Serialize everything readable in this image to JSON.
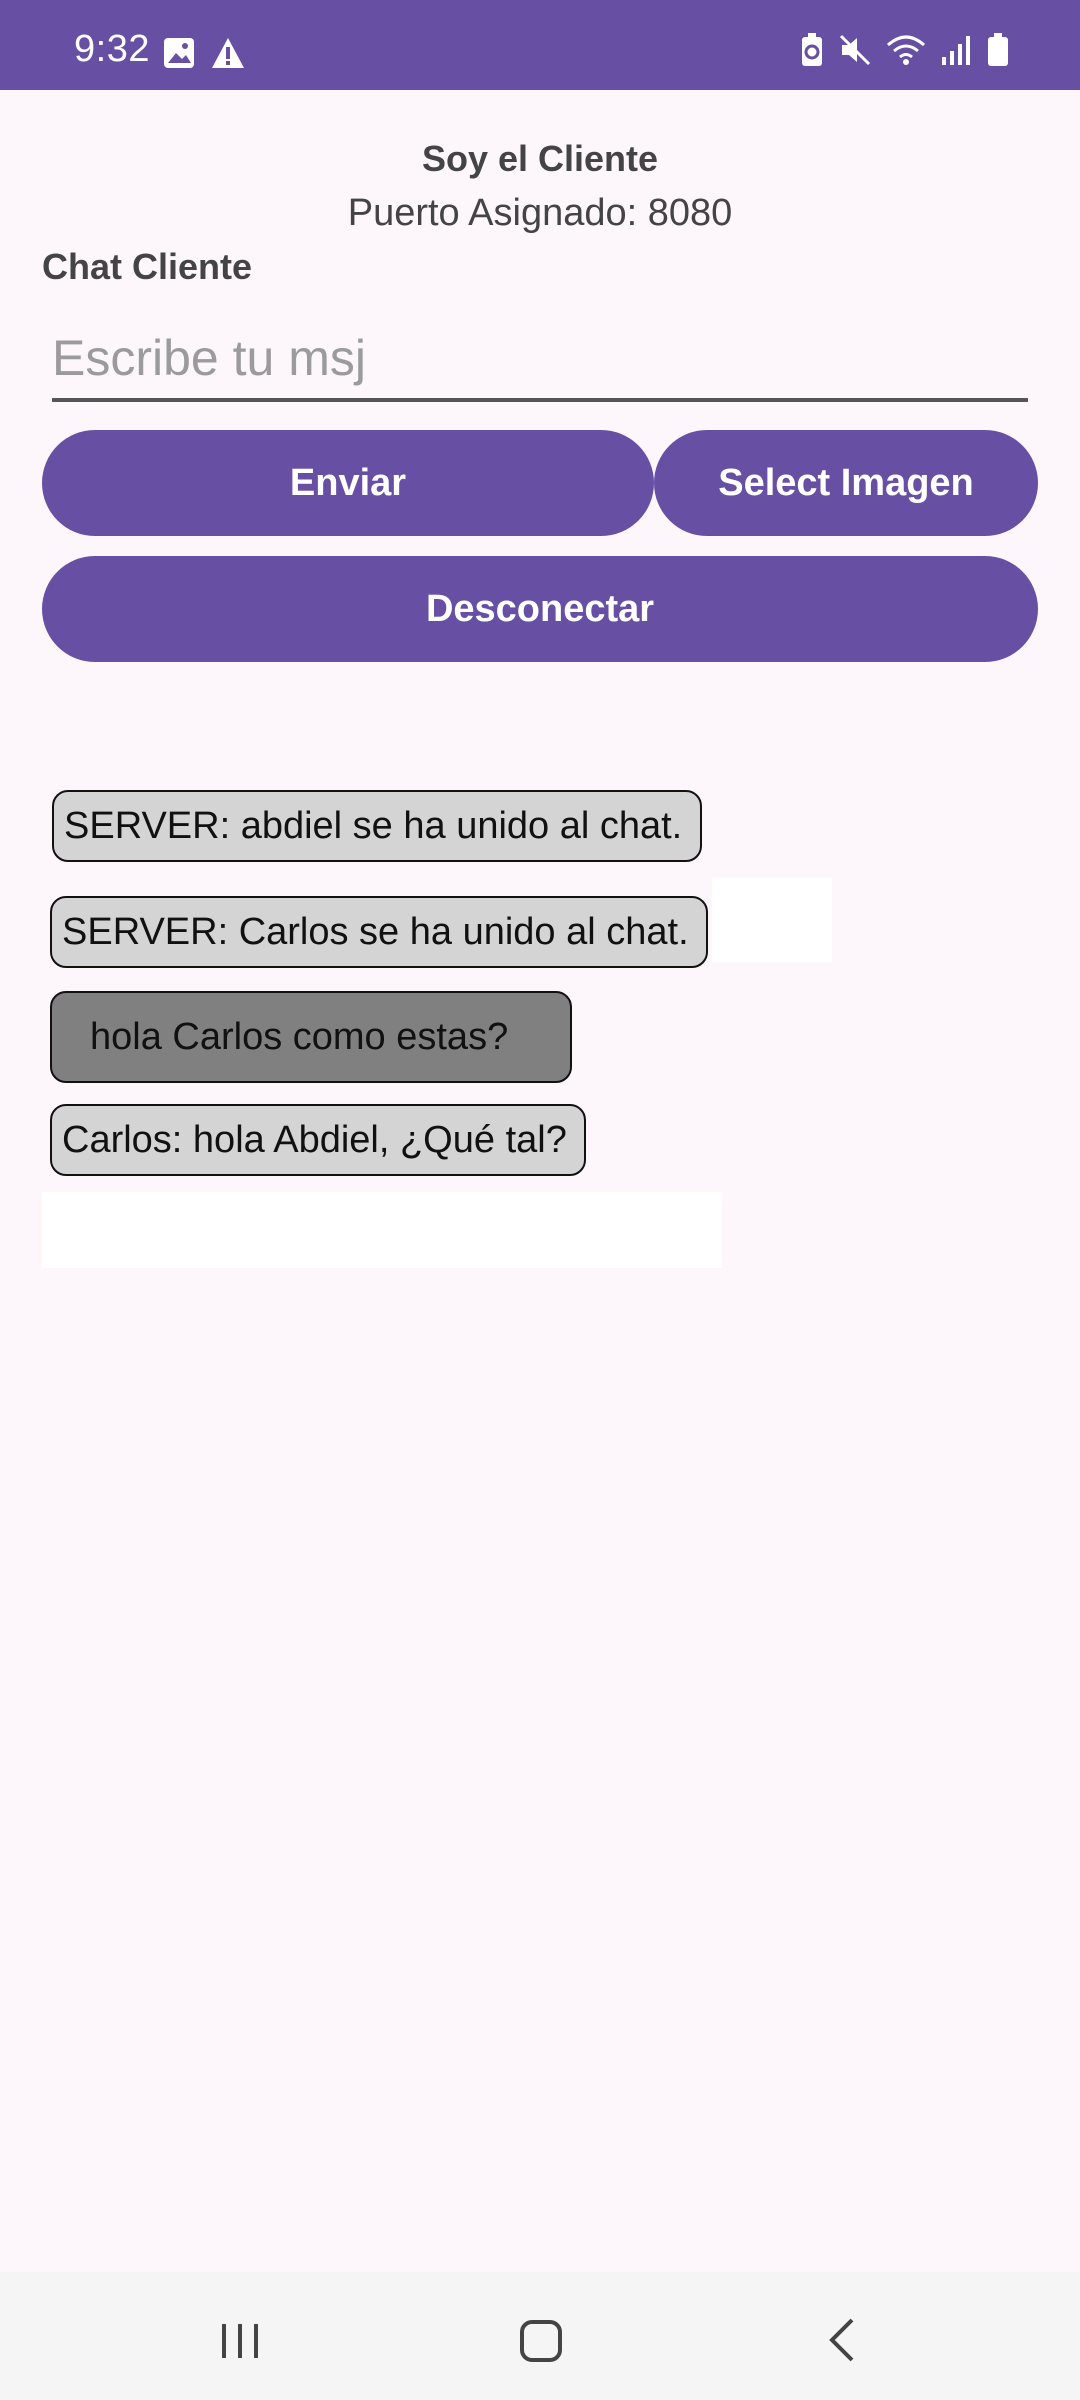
{
  "status_bar": {
    "time": "9:32",
    "left_icons": [
      "image-icon",
      "warning-icon"
    ],
    "right_icons": [
      "battery-saver-icon",
      "mute-icon",
      "wifi-icon",
      "signal-icon",
      "battery-icon"
    ],
    "background": "#6750a4"
  },
  "header": {
    "title": "Soy el Cliente",
    "port": "Puerto Asignado: 8080"
  },
  "chat": {
    "label": "Chat Cliente",
    "input_placeholder": "Escribe tu msj",
    "input_value": ""
  },
  "buttons": {
    "send": "Enviar",
    "select_image": "Select Imagen",
    "disconnect": "Desconectar"
  },
  "messages": [
    {
      "text": "SERVER: abdiel se ha unido al chat.",
      "type": "received"
    },
    {
      "text": "SERVER: Carlos se ha unido al chat.",
      "type": "received"
    },
    {
      "text": "hola Carlos como estas?",
      "type": "sent"
    },
    {
      "text": "Carlos: hola Abdiel, ¿Qué tal?",
      "type": "received"
    }
  ],
  "nav_bar": {
    "buttons": [
      "recents-icon",
      "home-icon",
      "back-icon"
    ]
  },
  "colors": {
    "accent": "#6750a4",
    "background": "#fdf7fc",
    "bubble_received": "#d4d4d4",
    "bubble_sent": "#808080"
  }
}
